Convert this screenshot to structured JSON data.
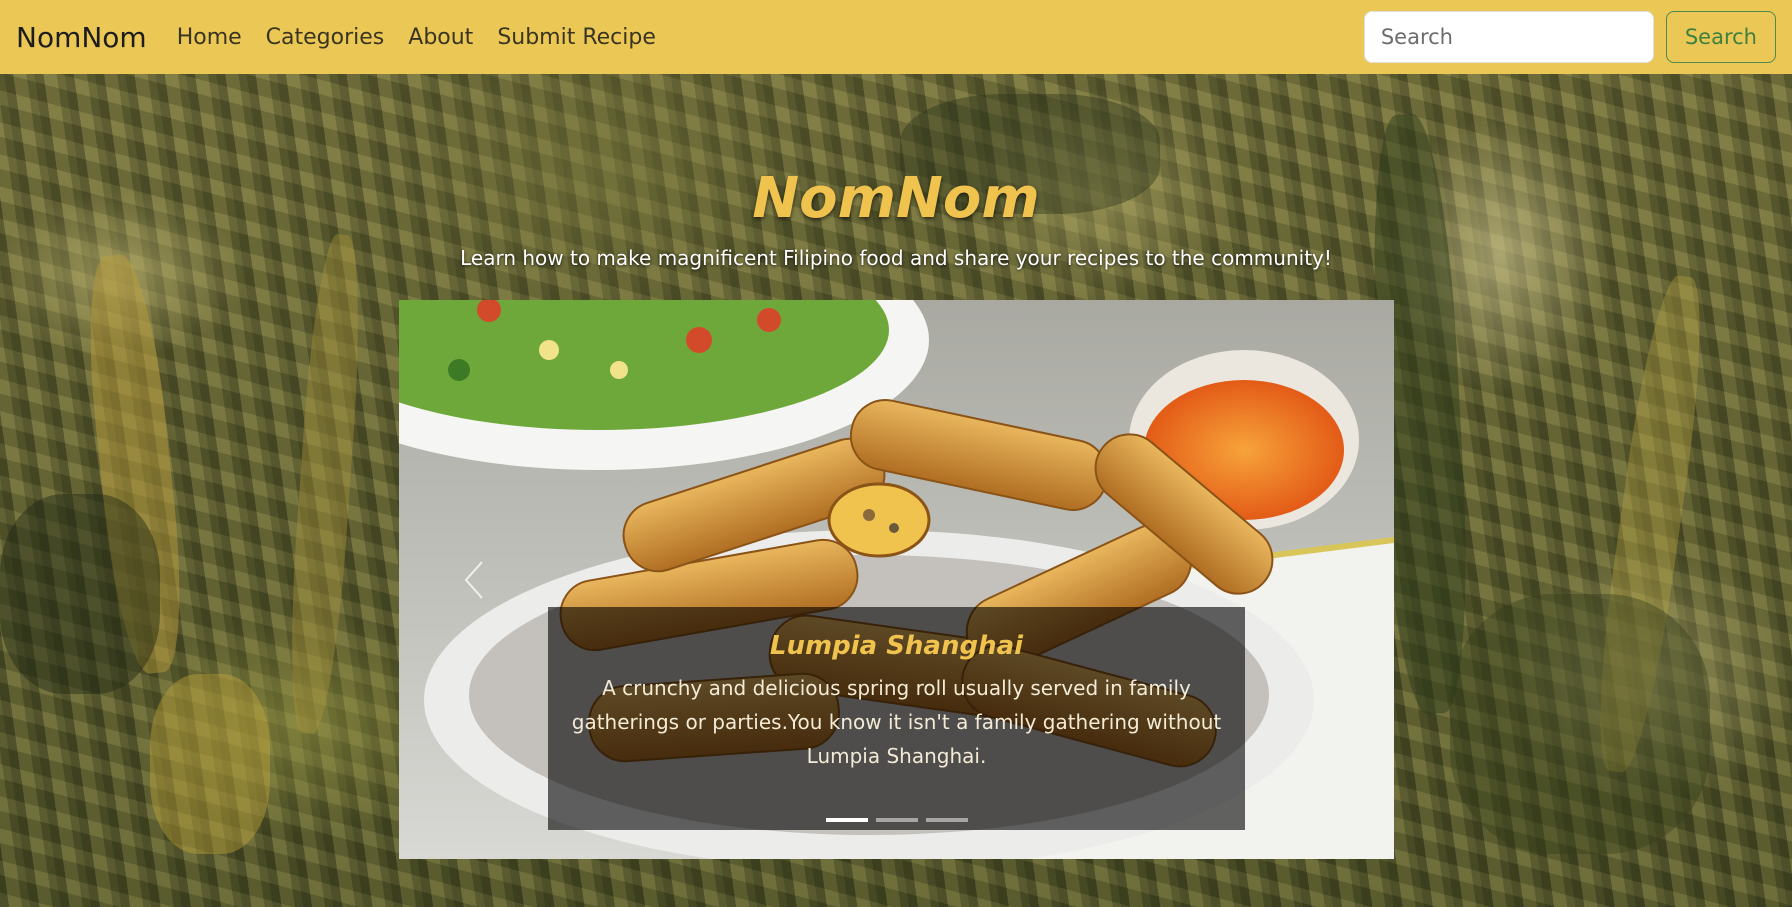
{
  "navbar": {
    "brand": "NomNom",
    "links": [
      "Home",
      "Categories",
      "About",
      "Submit Recipe"
    ],
    "search_placeholder": "Search",
    "search_value": "",
    "search_button": "Search"
  },
  "hero": {
    "title": "NomNom",
    "subtitle": "Learn how to make magnificent Filipino food and share your recipes to the community!"
  },
  "carousel": {
    "active_index": 0,
    "slide_count": 3,
    "slides": [
      {
        "title": "Lumpia Shanghai",
        "description": "A crunchy and delicious spring roll usually served in family gatherings or parties.You know it isn't a family gathering without Lumpia Shanghai."
      }
    ],
    "prev_icon": "chevron-left-icon"
  },
  "colors": {
    "navbar_bg": "#ebc755",
    "title_gold": "#f0c24e",
    "search_button_green": "#3f7f3f"
  }
}
